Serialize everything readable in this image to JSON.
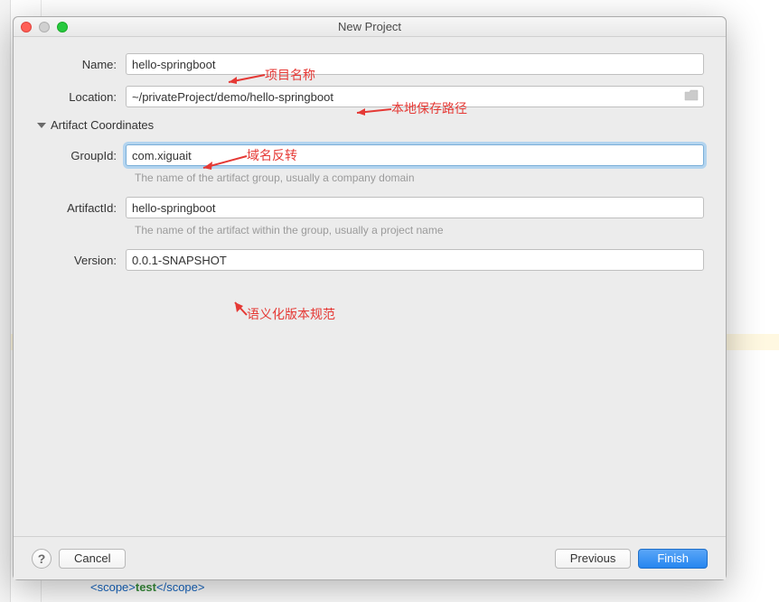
{
  "dialog": {
    "title": "New Project",
    "fields": {
      "name_label": "Name:",
      "name_value": "hello-springboot",
      "location_label": "Location:",
      "location_value": "~/privateProject/demo/hello-springboot",
      "section_title": "Artifact Coordinates",
      "groupid_label": "GroupId:",
      "groupid_value": "com.xiguait",
      "groupid_hint": "The name of the artifact group, usually a company domain",
      "artifactid_label": "ArtifactId:",
      "artifactid_value": "hello-springboot",
      "artifactid_hint": "The name of the artifact within the group, usually a project name",
      "version_label": "Version:",
      "version_value": "0.0.1-SNAPSHOT"
    },
    "buttons": {
      "help": "?",
      "cancel": "Cancel",
      "previous": "Previous",
      "finish": "Finish"
    }
  },
  "annotations": {
    "name": "项目名称",
    "location": "本地保存路径",
    "group": "域名反转",
    "version": "语义化版本规范"
  },
  "background": {
    "code_tag_open": "<scope>",
    "code_text": "test",
    "code_tag_close": "</scope>"
  }
}
